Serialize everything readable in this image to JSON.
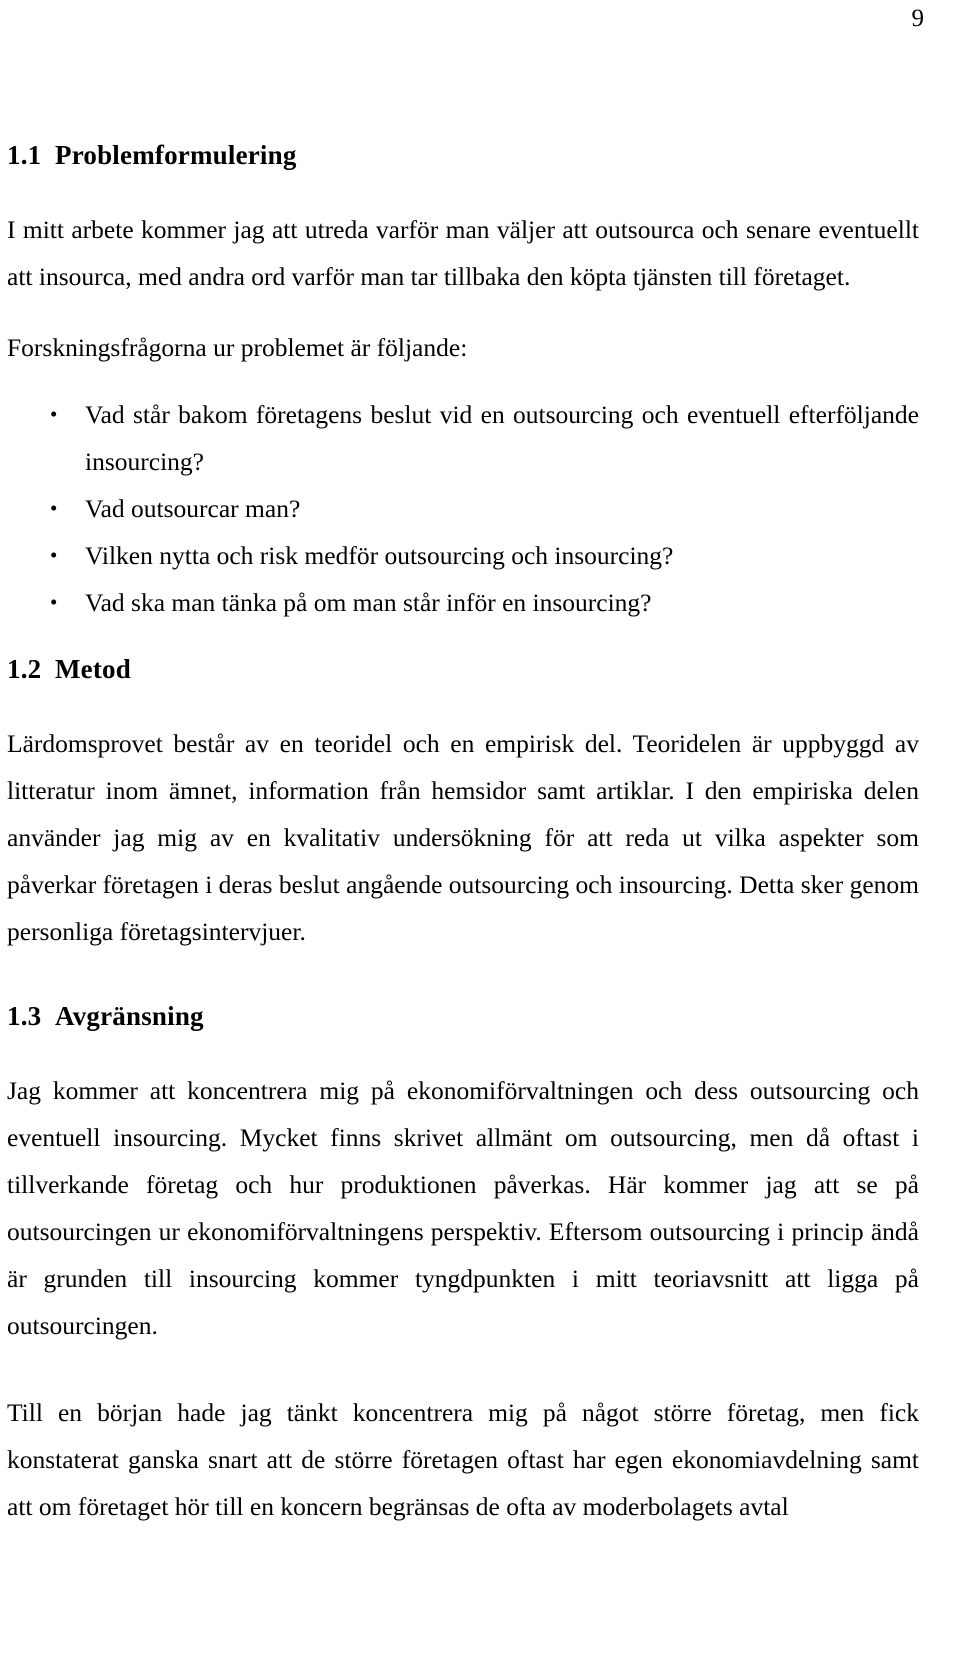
{
  "page": {
    "number": "9"
  },
  "sections": [
    {
      "heading_number": "1.1",
      "heading_title": "Problemformulering",
      "paragraph_1": "I mitt arbete kommer jag att utreda varför man väljer att outsourca och senare eventuellt att insourca, med andra ord varför man tar tillbaka den köpta tjänsten till företaget.",
      "paragraph_2": "Forskningsfrågorna ur problemet är följande:",
      "bullet_glyph": "•",
      "questions": [
        "Vad står bakom företagens beslut vid en outsourcing och eventuell efterföljande insourcing?",
        "Vad outsourcar man?",
        "Vilken nytta och risk medför outsourcing och insourcing?",
        "Vad ska man tänka på om man står inför en insourcing?"
      ]
    },
    {
      "heading_number": "1.2",
      "heading_title": "Metod",
      "paragraph_1": "Lärdomsprovet består av en teoridel och en empirisk del. Teoridelen är uppbyggd av litteratur inom ämnet, information från hemsidor samt artiklar. I den empiriska delen använder jag mig av en kvalitativ undersökning för att reda ut vilka aspekter som påverkar företagen i deras beslut angående outsourcing och insourcing. Detta sker genom personliga företagsintervjuer."
    },
    {
      "heading_number": "1.3",
      "heading_title": "Avgränsning",
      "paragraph_1": "Jag kommer att koncentrera mig på ekonomiförvaltningen och dess outsourcing och eventuell insourcing. Mycket finns skrivet allmänt om outsourcing, men då oftast i tillverkande företag och hur produktionen påverkas. Här kommer jag att se på outsourcingen ur ekonomiförvaltningens perspektiv. Eftersom outsourcing i princip ändå är grunden till insourcing kommer tyngdpunkten i mitt teoriavsnitt att ligga på outsourcingen.",
      "paragraph_2": "Till en början hade jag tänkt koncentrera mig på något större företag, men fick konstaterat ganska snart att de större företagen oftast har egen ekonomiavdelning samt att om företaget hör till en koncern begränsas de ofta av moderbolagets avtal"
    }
  ]
}
